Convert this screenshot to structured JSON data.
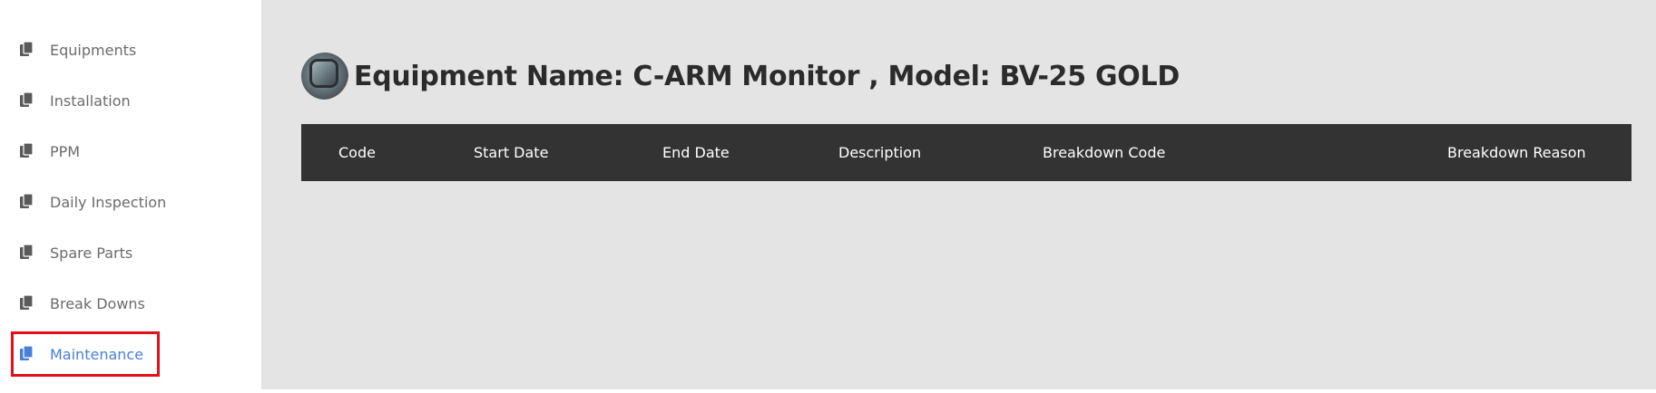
{
  "sidebar": {
    "items": [
      {
        "label": "Equipments",
        "icon": "copy-icon",
        "active": false
      },
      {
        "label": "Installation",
        "icon": "copy-icon",
        "active": false
      },
      {
        "label": "PPM",
        "icon": "copy-icon",
        "active": false
      },
      {
        "label": "Daily Inspection",
        "icon": "copy-icon",
        "active": false
      },
      {
        "label": "Spare Parts",
        "icon": "copy-icon",
        "active": false
      },
      {
        "label": "Break Downs",
        "icon": "copy-icon",
        "active": false
      },
      {
        "label": "Maintenance",
        "icon": "copy-icon",
        "active": true
      }
    ],
    "active_color": "#4a7fd8",
    "highlight_border_color": "#e2101b"
  },
  "main": {
    "title": "Equipment Name: C-ARM Monitor , Model: BV-25 GOLD",
    "thumbnail": "equipment-photo",
    "table": {
      "columns": [
        "Code",
        "Start Date",
        "End Date",
        "Description",
        "Breakdown Code",
        "Breakdown Reason"
      ],
      "rows": []
    },
    "header_bg": "#333333",
    "background": "#e4e4e4"
  }
}
